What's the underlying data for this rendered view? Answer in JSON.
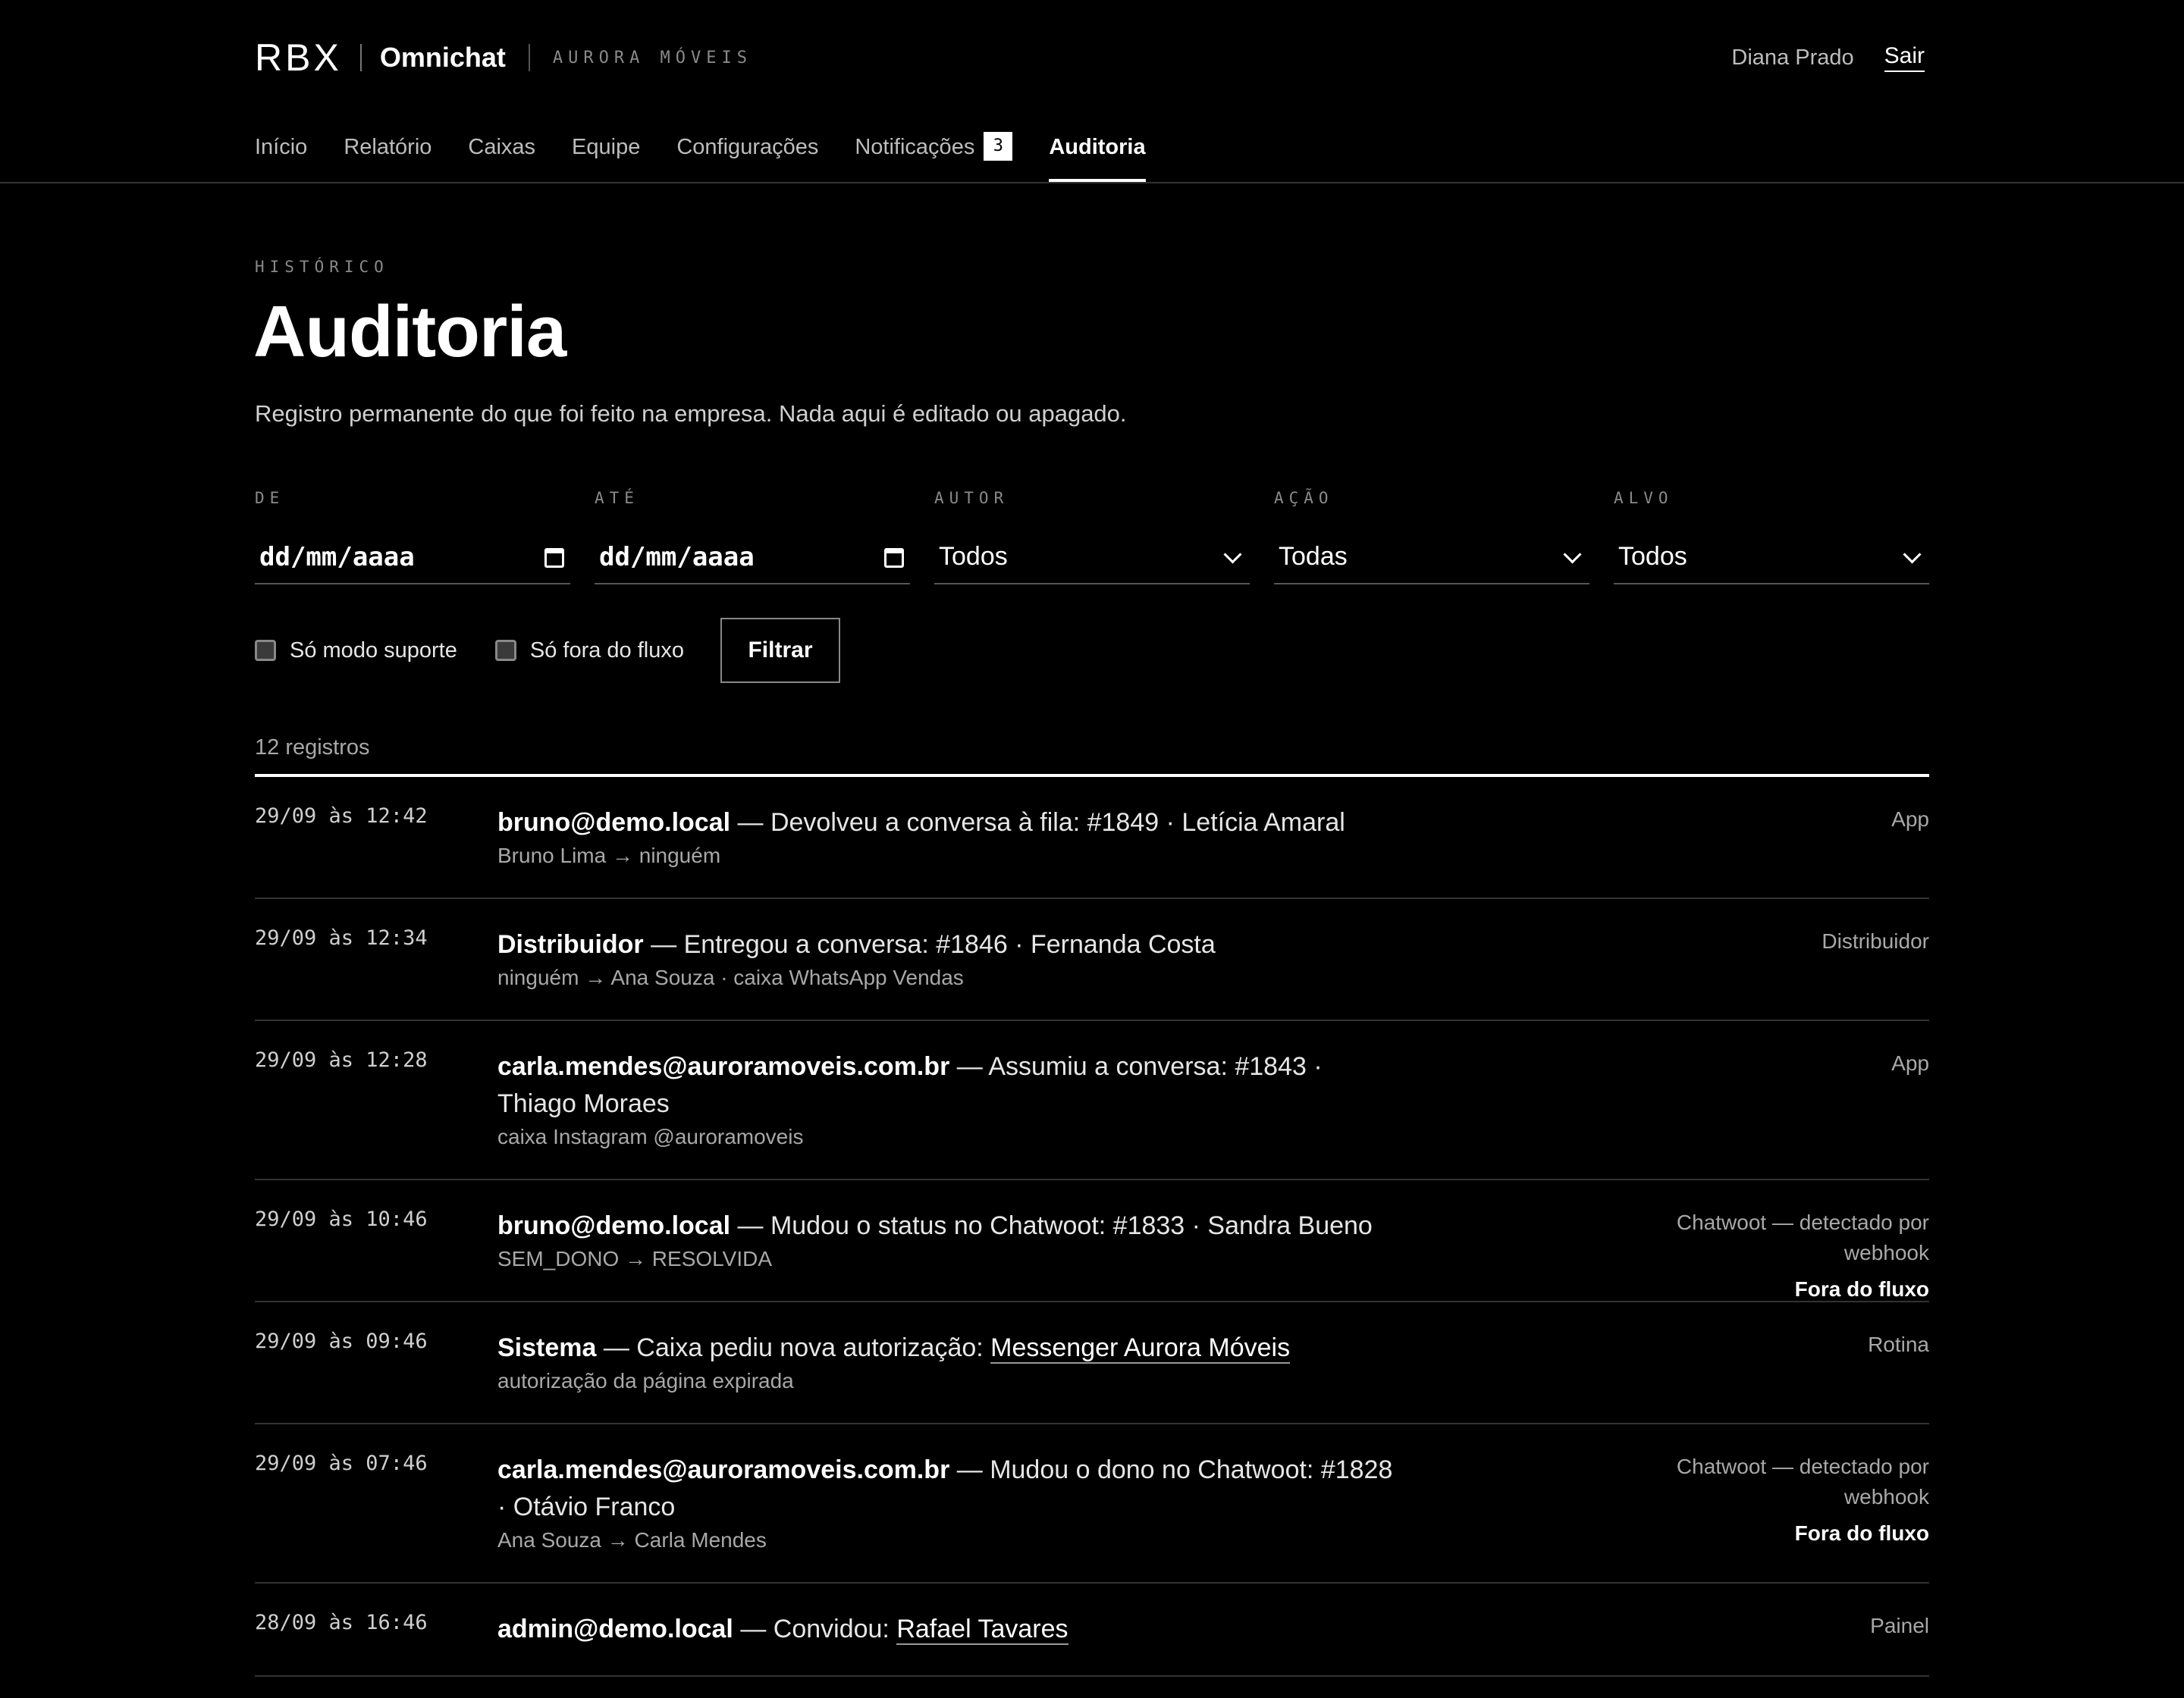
{
  "header": {
    "logo": "RBX",
    "app_name": "Omnichat",
    "company": "AURORA MÓVEIS",
    "user_name": "Diana Prado",
    "logout": "Sair"
  },
  "nav": {
    "items": [
      "Início",
      "Relatório",
      "Caixas",
      "Equipe",
      "Configurações",
      "Notificações",
      "Auditoria"
    ],
    "notifications_badge": "3",
    "active": "Auditoria"
  },
  "page": {
    "kicker": "HISTÓRICO",
    "title": "Auditoria",
    "subtitle": "Registro permanente do que foi feito na empresa. Nada aqui é editado ou apagado."
  },
  "filters": {
    "from": {
      "label": "DE",
      "value": "dd/mm/aaaa"
    },
    "to": {
      "label": "ATÉ",
      "value": "dd/mm/aaaa"
    },
    "author": {
      "label": "AUTOR",
      "value": "Todos"
    },
    "action": {
      "label": "AÇÃO",
      "value": "Todas"
    },
    "target": {
      "label": "ALVO",
      "value": "Todos"
    },
    "support_only": "Só modo suporte",
    "outside_flow_only": "Só fora do fluxo",
    "submit": "Filtrar"
  },
  "results": {
    "count": "12 registros",
    "rows": [
      {
        "time": "29/09 às 12:42",
        "actor": "bruno@demo.local",
        "action": " — Devolveu a conversa à fila: #1849 · Letícia Amaral",
        "link": "",
        "detail": "Bruno Lima → ninguém",
        "source": "App",
        "flag": ""
      },
      {
        "time": "29/09 às 12:34",
        "actor": "Distribuidor",
        "action": " — Entregou a conversa: #1846 · Fernanda Costa",
        "link": "",
        "detail": "ninguém → Ana Souza · caixa WhatsApp Vendas",
        "source": "Distribuidor",
        "flag": ""
      },
      {
        "time": "29/09 às 12:28",
        "actor": "carla.mendes@auroramoveis.com.br",
        "action": " — Assumiu a conversa: #1843 · Thiago Moraes",
        "link": "",
        "detail": "caixa Instagram @auroramoveis",
        "source": "App",
        "flag": ""
      },
      {
        "time": "29/09 às 10:46",
        "actor": "bruno@demo.local",
        "action": " — Mudou o status no Chatwoot: #1833 · Sandra Bueno",
        "link": "",
        "detail": "SEM_DONO → RESOLVIDA",
        "source": "Chatwoot — detectado por webhook",
        "flag": "Fora do fluxo"
      },
      {
        "time": "29/09 às 09:46",
        "actor": "Sistema",
        "action": " — Caixa pediu nova autorização: ",
        "link": "Messenger Aurora Móveis",
        "detail": "autorização da página expirada",
        "source": "Rotina",
        "flag": ""
      },
      {
        "time": "29/09 às 07:46",
        "actor": "carla.mendes@auroramoveis.com.br",
        "action": " — Mudou o dono no Chatwoot: #1828 · Otávio Franco",
        "link": "",
        "detail": "Ana Souza → Carla Mendes",
        "source": "Chatwoot — detectado por webhook",
        "flag": "Fora do fluxo"
      },
      {
        "time": "28/09 às 16:46",
        "actor": "admin@demo.local",
        "action": " — Convidou: ",
        "link": "Rafael Tavares",
        "detail": "",
        "source": "Painel",
        "flag": ""
      }
    ]
  }
}
